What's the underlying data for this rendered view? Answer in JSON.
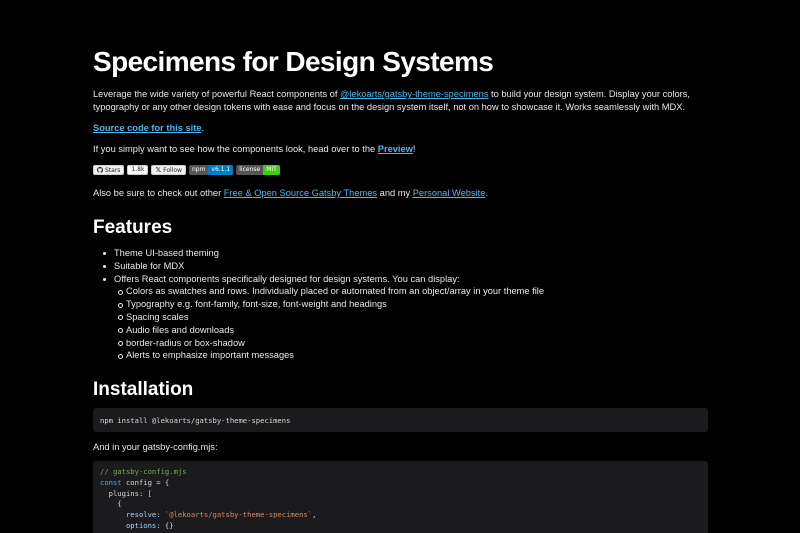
{
  "title": "Specimens for Design Systems",
  "intro": {
    "text_before": "Leverage the wide variety of powerful React components of ",
    "link": "@lekoarts/gatsby-theme-specimens",
    "text_after": " to build your design system. Display your colors, typography or any other design tokens with ease and focus on the design system itself, not on how to showcase it. Works seamlessly with MDX."
  },
  "source": {
    "link": "Source code for this site",
    "suffix": "."
  },
  "preview": {
    "text": "If you simply want to see how the components look, head over to the ",
    "link": "Preview",
    "suffix": "!"
  },
  "badges": {
    "stars_label": "Stars",
    "stars_count": "1.8k",
    "follow_label": "Follow",
    "npm_label": "npm",
    "npm_version": "v6.1.1",
    "license_label": "license",
    "license_value": "MIT"
  },
  "also": {
    "text": "Also be sure to check out other ",
    "link1": "Free & Open Source Gatsby Themes",
    "middle": " and my ",
    "link2": "Personal Website",
    "suffix": "."
  },
  "features": {
    "heading": "Features",
    "items": [
      "Theme UI-based theming",
      "Suitable for MDX",
      "Offers React components specifically designed for design systems. You can display:"
    ],
    "subitems": [
      "Colors as swatches and rows. Individually placed or automated from an object/array in your theme file",
      "Typography e.g. font-family, font-size, font-weight and headings",
      "Spacing scales",
      "Audio files and downloads",
      "border-radius or box-shadow",
      "Alerts to emphasize important messages"
    ]
  },
  "installation": {
    "heading": "Installation",
    "command": "npm install @lekoarts/gatsby-theme-specimens",
    "config_text": "And in your gatsby-config.mjs:",
    "code": {
      "comment": "// gatsby-config.mjs",
      "l2_kw": "const",
      "l2_rest": " config = {",
      "l3": "  plugins: [",
      "l4": "    {",
      "l5_key": "      resolve:",
      "l5_str": " `@lekoarts/gatsby-theme-specimens`",
      "l5_end": ",",
      "l6_key": "      options:",
      "l6_rest": " {}",
      "l7": "    },"
    }
  }
}
